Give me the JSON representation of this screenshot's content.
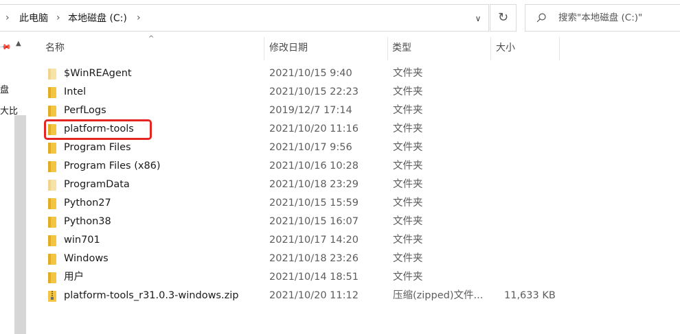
{
  "address_bar": {
    "breadcrumbs": [
      "此电脑",
      "本地磁盘 (C:)"
    ],
    "search_placeholder": "搜索\"本地磁盘 (C:)\""
  },
  "nav_pane": {
    "fragments": [
      "盘",
      "大比"
    ]
  },
  "columns": {
    "name": "名称",
    "date_modified": "修改日期",
    "type": "类型",
    "size": "大小",
    "sorted_by": "名称"
  },
  "files": [
    {
      "name": "$WinREAgent",
      "date": "2021/10/15 9:40",
      "type": "文件夹",
      "size": "",
      "icon": "folder-icon",
      "faded": true
    },
    {
      "name": "Intel",
      "date": "2021/10/15 22:23",
      "type": "文件夹",
      "size": "",
      "icon": "folder-icon",
      "faded": false
    },
    {
      "name": "PerfLogs",
      "date": "2019/12/7 17:14",
      "type": "文件夹",
      "size": "",
      "icon": "folder-icon",
      "faded": false
    },
    {
      "name": "platform-tools",
      "date": "2021/10/20 11:16",
      "type": "文件夹",
      "size": "",
      "icon": "folder-icon",
      "faded": false,
      "highlighted": true
    },
    {
      "name": "Program Files",
      "date": "2021/10/17 9:56",
      "type": "文件夹",
      "size": "",
      "icon": "folder-icon",
      "faded": false
    },
    {
      "name": "Program Files (x86)",
      "date": "2021/10/16 10:28",
      "type": "文件夹",
      "size": "",
      "icon": "folder-icon",
      "faded": false
    },
    {
      "name": "ProgramData",
      "date": "2021/10/18 23:29",
      "type": "文件夹",
      "size": "",
      "icon": "folder-icon",
      "faded": true
    },
    {
      "name": "Python27",
      "date": "2021/10/15 15:59",
      "type": "文件夹",
      "size": "",
      "icon": "folder-icon",
      "faded": false
    },
    {
      "name": "Python38",
      "date": "2021/10/15 16:07",
      "type": "文件夹",
      "size": "",
      "icon": "folder-icon",
      "faded": false
    },
    {
      "name": "win701",
      "date": "2021/10/17 14:20",
      "type": "文件夹",
      "size": "",
      "icon": "folder-icon",
      "faded": false
    },
    {
      "name": "Windows",
      "date": "2021/10/18 23:26",
      "type": "文件夹",
      "size": "",
      "icon": "folder-icon",
      "faded": false
    },
    {
      "name": "用户",
      "date": "2021/10/14 18:51",
      "type": "文件夹",
      "size": "",
      "icon": "folder-icon",
      "faded": false
    },
    {
      "name": "platform-tools_r31.0.3-windows.zip",
      "date": "2021/10/20 11:12",
      "type": "压缩(zipped)文件...",
      "size": "11,633 KB",
      "icon": "zip-folder-icon",
      "faded": false
    }
  ],
  "colors": {
    "folder": "#f4c542",
    "folder_faded": "#f8e3a6",
    "highlight": "#e52521"
  }
}
